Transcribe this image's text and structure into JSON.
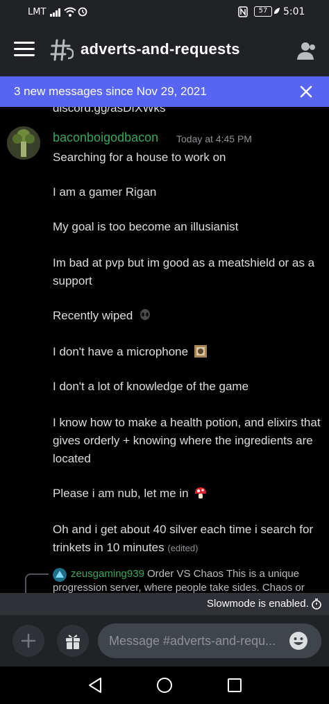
{
  "status_bar": {
    "carrier": "LMT",
    "battery": "57",
    "time": "5:01",
    "icons": [
      "signal-icon",
      "wifi-icon",
      "alarm-icon",
      "nfc-icon",
      "battery-icon",
      "eco-leaf-icon"
    ]
  },
  "header": {
    "menu_icon": "hamburger-menu-icon",
    "channel_icon": "thread-hash-icon",
    "channel_name": "adverts-and-requests",
    "members_icon": "members-icon"
  },
  "banner": {
    "text": "3 new messages since Nov 29, 2021",
    "close_icon": "close-icon"
  },
  "messages": {
    "previous_line": "discord.gg/asDfXWks",
    "author": "baconboigodbacon",
    "timestamp": "Today at 4:45 PM",
    "lines": [
      "Searching for a house to work on",
      "I am a gamer Rigan",
      "My goal is too become an illusianist",
      "Im bad at pvp but im good as a meatshield or as a support",
      "Recently wiped",
      "I don't have a microphone",
      "I don't a lot of knowledge of the game",
      "I know how to make a health potion, and elixirs that gives orderly + knowing where the ingredients are located",
      "Please i am nub, let me in",
      "Oh and i get about 40 silver each time i search for trinkets in 10 minutes"
    ],
    "edited_label": "(edited)",
    "reply": {
      "user": "zeusgaming939",
      "text": "Order VS Chaos This is a unique",
      "text2": "progression server, where people take sides. Chaos or"
    }
  },
  "slowmode": {
    "text": "Slowmode is enabled.",
    "icon": "timer-icon"
  },
  "composer": {
    "add_icon": "plus-icon",
    "gift_icon": "gift-icon",
    "placeholder": "Message #adverts-and-requ...",
    "emoji_icon": "emoji-icon"
  },
  "navbar": {
    "icons": [
      "back-icon",
      "home-icon",
      "recents-icon"
    ]
  },
  "colors": {
    "accent": "#5865f2",
    "username": "#3ba55d",
    "header_bg": "#202225",
    "input_bg": "#40444b"
  }
}
